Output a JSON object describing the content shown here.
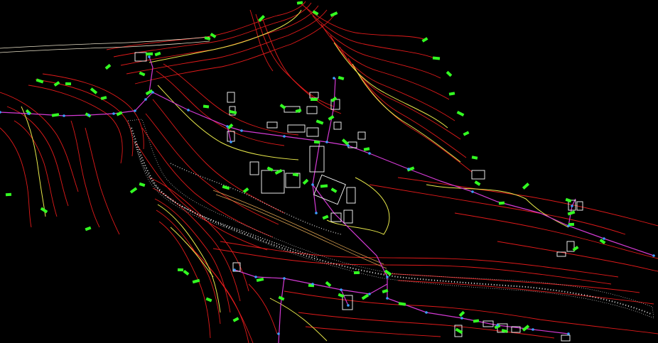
{
  "app": {
    "kind": "CAD topographic drawing viewport"
  },
  "colors": {
    "background": "#000000",
    "contour_major": "#e8e84a",
    "contour_minor": "#e01a1a",
    "contour_dark": "#a01414",
    "network_line": "#d43ad4",
    "road_edge": "#e8e0c8",
    "marker": "#33ff22",
    "node": "#3aa0ff",
    "building": "#ffffff",
    "river_dots": "#f0f0f0"
  },
  "layers": [
    "contours",
    "river-bed",
    "road",
    "network",
    "buildings",
    "markers",
    "nodes"
  ]
}
